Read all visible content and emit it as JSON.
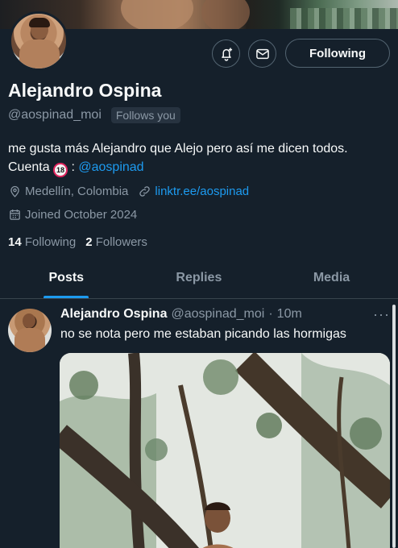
{
  "profile": {
    "name": "Alejandro Ospina",
    "handle": "@aospinad_moi",
    "follows_you": "Follows you",
    "bio_text": "me gusta más Alejandro que Alejo pero así me dicen todos. Cuenta ",
    "bio_badge": "18",
    "bio_sep": " : ",
    "bio_link": "@aospinad",
    "location": "Medellín, Colombia",
    "website": "linktr.ee/aospinad",
    "joined": "Joined October 2024",
    "following_count": "14",
    "following_label": "Following",
    "followers_count": "2",
    "followers_label": "Followers"
  },
  "actions": {
    "notify_icon": "bell-plus-icon",
    "message_icon": "envelope-icon",
    "follow_label": "Following"
  },
  "tabs": [
    {
      "label": "Posts",
      "active": true
    },
    {
      "label": "Replies",
      "active": false
    },
    {
      "label": "Media",
      "active": false
    }
  ],
  "tweet": {
    "author": "Alejandro Ospina",
    "handle": "@aospinad_moi",
    "separator": "·",
    "time": "10m",
    "more": "···",
    "text": "no se nota pero me estaban picando las hormigas"
  },
  "colors": {
    "background": "#15202b",
    "accent": "#1d9bf0",
    "secondary_text": "#8b98a5"
  }
}
